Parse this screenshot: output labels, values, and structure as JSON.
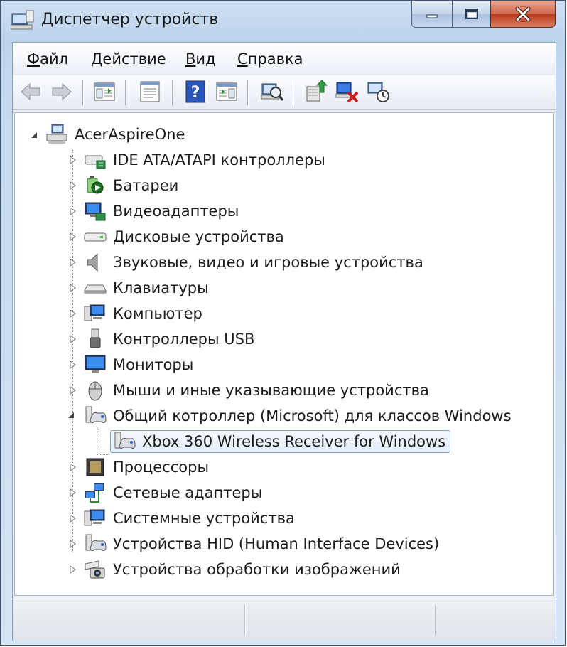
{
  "window": {
    "title": "Диспетчер устройств",
    "icon": "device-manager-icon",
    "controls": [
      "minimize-icon",
      "maximize-icon",
      "close-icon"
    ]
  },
  "menu": {
    "items": [
      {
        "label": "Файл"
      },
      {
        "label": "Действие"
      },
      {
        "label": "Вид"
      },
      {
        "label": "Справка"
      }
    ]
  },
  "toolbar": {
    "buttons": [
      {
        "icon": "back-arrow-icon"
      },
      {
        "icon": "forward-arrow-icon"
      },
      {
        "icon": "show-hide-console-tree-icon"
      },
      {
        "icon": "properties-icon"
      },
      {
        "icon": "help-icon"
      },
      {
        "icon": "action-pane-icon"
      },
      {
        "icon": "scan-hardware-changes-icon"
      },
      {
        "icon": "update-driver-icon"
      },
      {
        "icon": "uninstall-device-icon"
      },
      {
        "icon": "disable-device-icon"
      }
    ]
  },
  "tree": {
    "root": {
      "label": "AcerAspireOne",
      "icon": "computer-root-icon"
    },
    "categories": [
      {
        "label": "IDE ATA/ATAPI контроллеры",
        "icon": "ide-controller-icon"
      },
      {
        "label": "Батареи",
        "icon": "battery-icon"
      },
      {
        "label": "Видеоадаптеры",
        "icon": "display-adapter-icon"
      },
      {
        "label": "Дисковые устройства",
        "icon": "disk-drive-icon"
      },
      {
        "label": "Звуковые, видео и игровые устройства",
        "icon": "speaker-icon"
      },
      {
        "label": "Клавиатуры",
        "icon": "keyboard-icon"
      },
      {
        "label": "Компьютер",
        "icon": "computer-icon"
      },
      {
        "label": "Контроллеры USB",
        "icon": "usb-icon"
      },
      {
        "label": "Мониторы",
        "icon": "monitor-icon"
      },
      {
        "label": "Мыши и иные указывающие устройства",
        "icon": "mouse-icon"
      },
      {
        "label": "Общий котроллер (Microsoft) для классов Windows",
        "icon": "gamepad-icon"
      },
      {
        "label": "Xbox 360 Wireless Receiver for Windows",
        "icon": "gamepad-device-icon"
      },
      {
        "label": "Процессоры",
        "icon": "processor-icon"
      },
      {
        "label": "Сетевые адаптеры",
        "icon": "network-adapter-icon"
      },
      {
        "label": "Системные устройства",
        "icon": "system-devices-icon"
      },
      {
        "label": "Устройства HID (Human Interface Devices)",
        "icon": "hid-icon"
      },
      {
        "label": "Устройства обработки изображений",
        "icon": "imaging-device-icon"
      }
    ]
  },
  "colors": {
    "accent": "#1f6fbf",
    "selection_border": "#7da2ce",
    "close_button": "#c4462a"
  }
}
